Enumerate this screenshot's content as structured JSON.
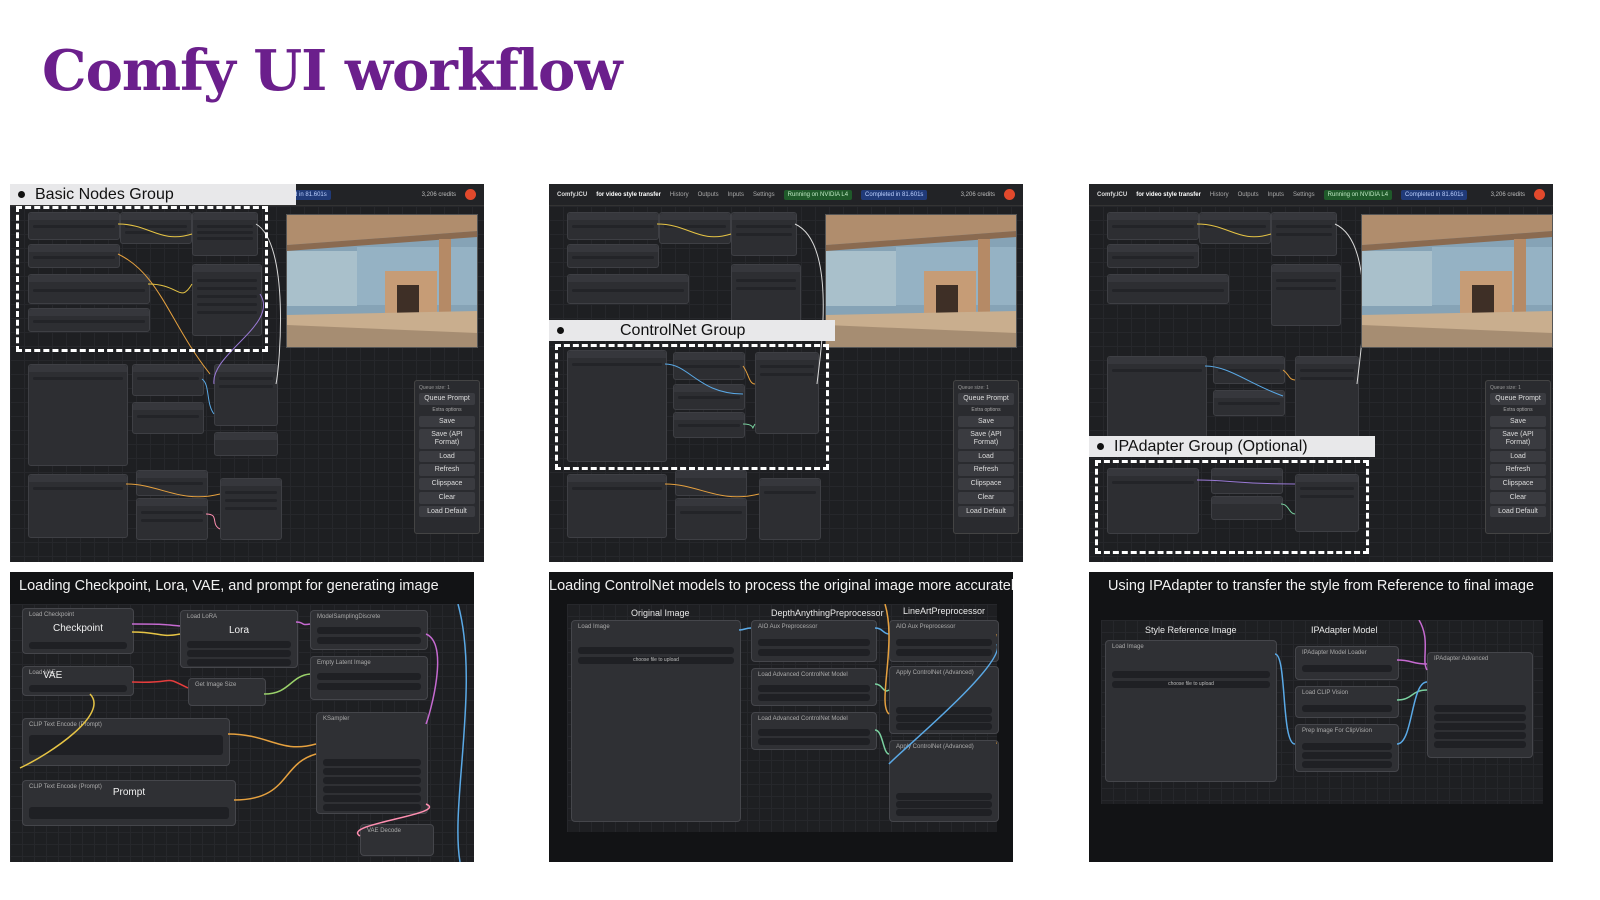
{
  "slide": {
    "title": "Comfy UI workflow"
  },
  "comfy_topbar": {
    "logo": "Comfy.ICU",
    "workflow_name": "for video style transfer",
    "menu": [
      "History",
      "Outputs",
      "Inputs",
      "Settings"
    ],
    "gpu_status": "Running on NVIDIA L4",
    "run_status": "Completed in 81.601s",
    "credits": "3,206 credits"
  },
  "queue_panel": {
    "header": "Queue size: 1",
    "queue_prompt": "Queue Prompt",
    "extra_options": "Extra options",
    "buttons": [
      "Save",
      "Save (API Format)",
      "Load",
      "Refresh",
      "Clipspace",
      "Clear",
      "Load Default"
    ]
  },
  "groups": {
    "basic": "Basic Nodes Group",
    "controlnet": "ControlNet Group",
    "ipadapter": "IPAdapter Group (Optional)"
  },
  "captions": {
    "basic": "Loading Checkpoint, Lora, VAE, and prompt for generating image",
    "controlnet": "Loading ControlNet models to process the original image more accurately",
    "ipadapter": "Using IPAdapter to transfer the style from Reference to final image"
  },
  "zoom_basic": {
    "load_checkpoint": "Load Checkpoint",
    "checkpoint": "Checkpoint",
    "load_lora": "Load LoRA",
    "lora": "Lora",
    "load_vae": "Load VAE",
    "vae": "VAE",
    "model_sampling": "ModelSamplingDiscrete",
    "empty_latent": "Empty Latent Image",
    "get_image_size": "Get Image Size",
    "clip_text_encode": "CLIP Text Encode (Prompt)",
    "prompt": "Prompt",
    "ksampler": "KSampler",
    "vae_decode": "VAE Decode"
  },
  "zoom_controlnet": {
    "original_image": "Original Image",
    "depth": "DepthAnythingPreprocessor",
    "lineart": "LineArtPreprocessor",
    "load_image": "Load Image",
    "aux": "AIO Aux Preprocessor",
    "load_advanced_cn": "Load Advanced ControlNet Model",
    "apply_cn": "Apply ControlNet (Advanced)",
    "choose_file": "choose file to upload"
  },
  "zoom_ipadapter": {
    "style_reference": "Style Reference Image",
    "ipadapter_model": "IPAdapter Model",
    "load_image": "Load Image",
    "model_loader": "IPAdapter Model Loader",
    "clip_vision": "Load CLIP Vision",
    "prep_image": "Prep Image For ClipVision",
    "ipadapter_advanced": "IPAdapter Advanced",
    "choose_file": "choose file to upload"
  }
}
